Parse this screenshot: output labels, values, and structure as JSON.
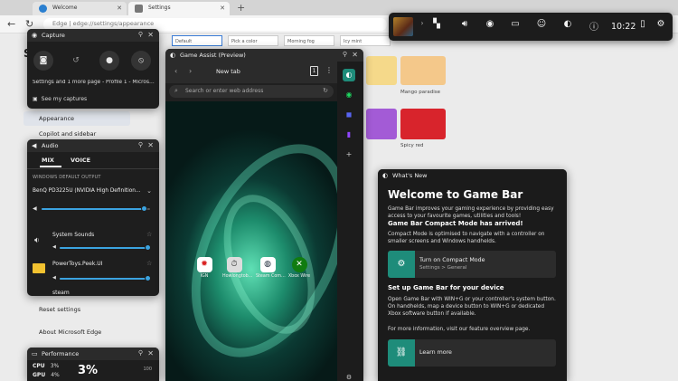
{
  "browser": {
    "tabs": [
      {
        "label": "Welcome"
      },
      {
        "label": "Settings"
      }
    ],
    "new_tab": "+",
    "back": "←",
    "refresh": "↻",
    "address": "Edge | edge://settings/appearance",
    "theme_swatches": [
      "Default",
      "Pick a color",
      "Morning fog",
      "Icy mint"
    ],
    "theme_labels": [
      "Mango paradise",
      "Spicy red"
    ],
    "sidebar_items": [
      "Appearance",
      "Copilot and sidebar",
      "Reset settings",
      "About Microsoft Edge"
    ],
    "partial_text": "Se"
  },
  "gamebar": {
    "time": "10:22",
    "icons": [
      "widget-menu-icon",
      "audio-icon",
      "capture-icon",
      "performance-icon",
      "xbox-social-icon",
      "edge-icon",
      "tips-icon",
      "battery-icon",
      "settings-icon"
    ]
  },
  "capture": {
    "title": "Capture",
    "info": "Settings and 1 more page - Profile 1 - Micros…",
    "see_captures": "See my captures"
  },
  "audio": {
    "title": "Audio",
    "tab_mix": "MIX",
    "tab_voice": "VOICE",
    "output_label": "WINDOWS DEFAULT OUTPUT",
    "device": "BenQ PD3225U (NVIDIA High Definition…",
    "master_level": 0.95,
    "apps": [
      {
        "name": "System Sounds",
        "level": 0.98
      },
      {
        "name": "PowerToys.Peek.UI",
        "level": 0.98
      },
      {
        "name": "steam",
        "level": 0.98
      }
    ]
  },
  "performance": {
    "title": "Performance",
    "cpu_label": "CPU",
    "cpu_value": "3%",
    "gpu_label": "GPU",
    "gpu_value": "4%",
    "big_value": "3%",
    "max_label": "100"
  },
  "assist": {
    "title": "Game Assist (Preview)",
    "tab_title": "New tab",
    "tab_count": "1",
    "search_placeholder": "Search or enter web address",
    "quick_links": [
      {
        "label": "IGN",
        "icon": "ign-icon"
      },
      {
        "label": "Howlongtob…",
        "icon": "howlongtobeat-icon"
      },
      {
        "label": "Steam Com…",
        "icon": "steam-icon"
      },
      {
        "label": "Xbox Wire",
        "icon": "xbox-icon"
      }
    ]
  },
  "whatsnew": {
    "header": "What's New",
    "title": "Welcome to Game Bar",
    "intro": "Game Bar improves your gaming experience by providing easy access to your favourite games, utilities and tools!",
    "compact_heading": "Game Bar Compact Mode has arrived!",
    "compact_text": "Compact Mode is optimised to navigate with a controller on smaller screens and Windows handhelds.",
    "card1_title": "Turn on Compact Mode",
    "card1_sub": "Settings > General",
    "setup_heading": "Set up Game Bar for your device",
    "setup_text": "Open Game Bar with WIN+G or your controller's system button. On handhelds, map a device button to WIN+G or dedicated Xbox software button if available.",
    "more_text": "For more information, visit our feature overview page.",
    "card2_title": "Learn more"
  }
}
